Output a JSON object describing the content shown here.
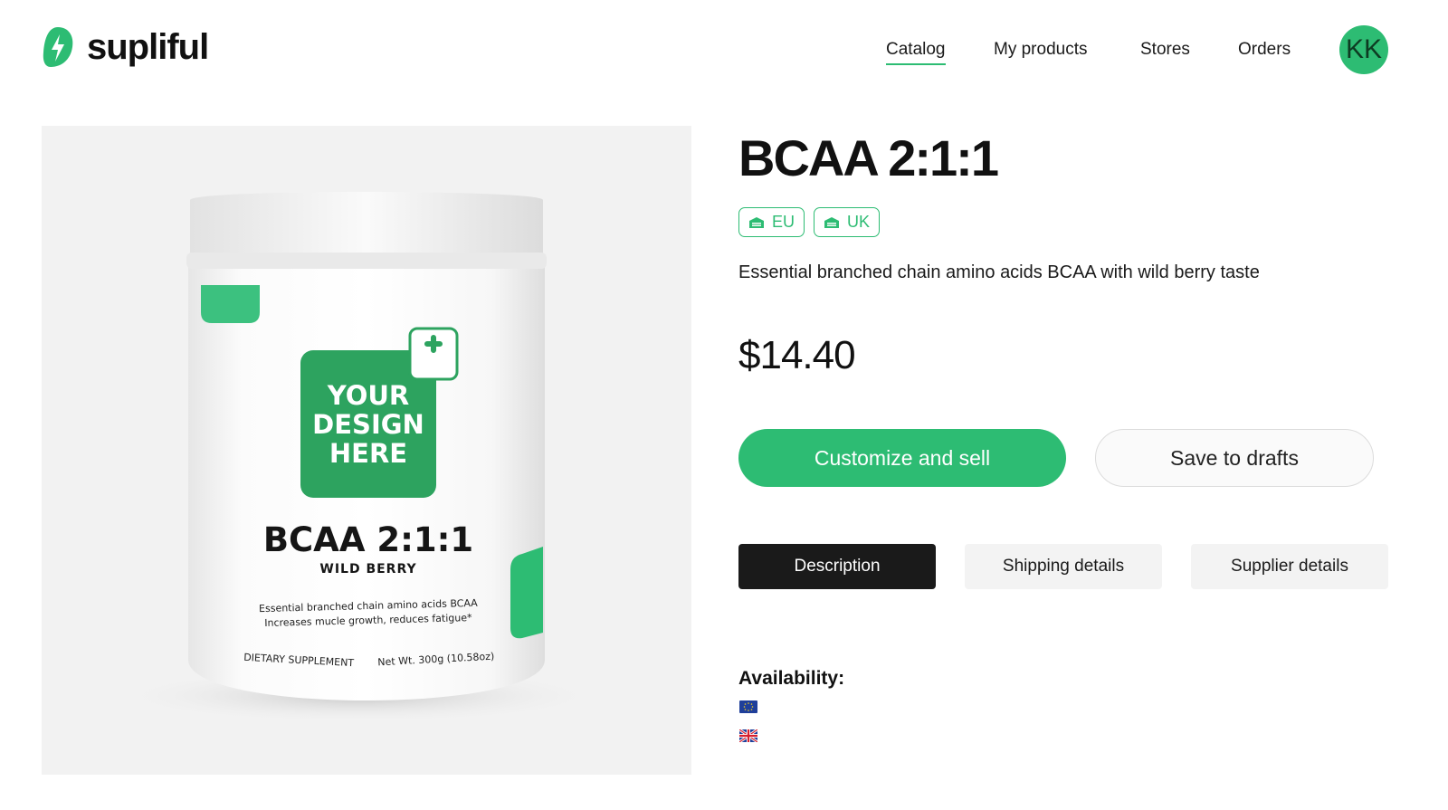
{
  "brand": {
    "name": "supliful",
    "logo_icon": "lightning-bolt-leaf-icon",
    "accent_color": "#2dbc73"
  },
  "nav": {
    "items": [
      {
        "label": "Catalog",
        "active": true
      },
      {
        "label": "My products",
        "active": false
      },
      {
        "label": "Stores",
        "active": false
      },
      {
        "label": "Orders",
        "active": false
      }
    ],
    "avatar_initials": "KK"
  },
  "product_image": {
    "label_title": "BCAA 2:1:1",
    "label_flavor": "WILD BERRY",
    "design_placeholder": [
      "YOUR",
      "DESIGN",
      "HERE"
    ],
    "label_desc_line1": "Essential branched chain amino acids BCAA",
    "label_desc_line2": "Increases mucle growth, reduces fatigue*",
    "label_footer_left": "DIETARY SUPPLEMENT",
    "label_footer_right": "Net Wt. 300g (10.58oz)"
  },
  "product": {
    "title": "BCAA 2:1:1",
    "regions": [
      {
        "label": "EU",
        "icon": "warehouse-icon"
      },
      {
        "label": "UK",
        "icon": "warehouse-icon"
      }
    ],
    "description": "Essential branched chain amino acids BCAA with wild berry taste",
    "price": "$14.40"
  },
  "actions": {
    "primary_label": "Customize and sell",
    "secondary_label": "Save to drafts"
  },
  "tabs": [
    {
      "label": "Description",
      "active": true
    },
    {
      "label": "Shipping details",
      "active": false
    },
    {
      "label": "Supplier details",
      "active": false
    }
  ],
  "availability": {
    "title": "Availability:",
    "flags": [
      "eu-flag-icon",
      "uk-flag-icon"
    ]
  }
}
